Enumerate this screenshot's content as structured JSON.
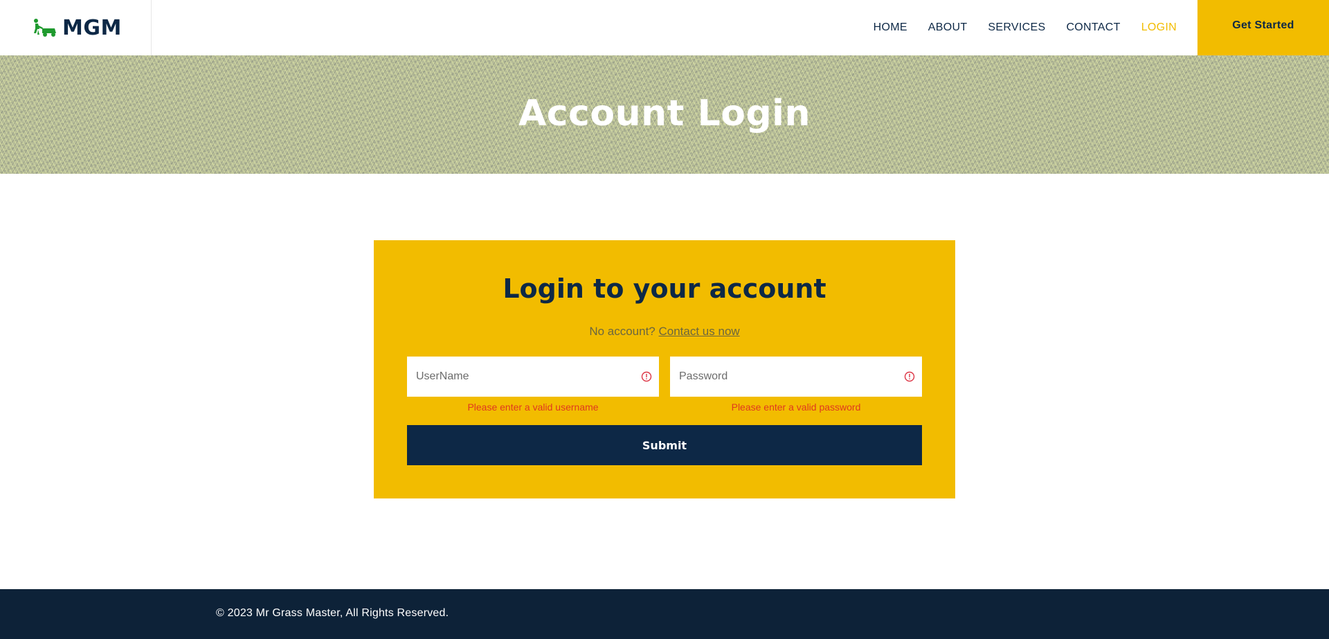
{
  "header": {
    "brand_name": "MGM",
    "brand_icon": "lawn-mower-icon",
    "nav": [
      {
        "label": "HOME",
        "active": false
      },
      {
        "label": "ABOUT",
        "active": false
      },
      {
        "label": "SERVICES",
        "active": false
      },
      {
        "label": "CONTACT",
        "active": false
      },
      {
        "label": "LOGIN",
        "active": true
      }
    ],
    "cta_label": "Get Started"
  },
  "hero": {
    "title": "Account Login"
  },
  "login": {
    "title": "Login to your account",
    "no_account_text": "No account?",
    "contact_link": "Contact us now",
    "username": {
      "placeholder": "UserName",
      "value": "",
      "error": "Please enter a valid username",
      "error_icon": "alert-circle-icon"
    },
    "password": {
      "placeholder": "Password",
      "value": "",
      "error": "Please enter a valid password",
      "error_icon": "alert-circle-icon"
    },
    "submit_label": "Submit"
  },
  "footer": {
    "copyright": "© 2023 Mr Grass Master, All Rights Reserved."
  },
  "colors": {
    "accent": "#f2bc00",
    "navy": "#0d2846",
    "footer": "#0d2238",
    "error": "#e0381f"
  }
}
